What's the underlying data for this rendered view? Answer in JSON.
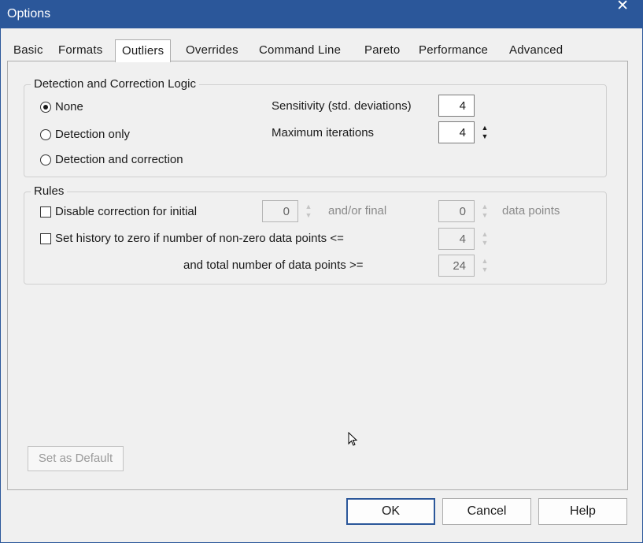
{
  "window": {
    "title": "Options",
    "close_glyph": "✕"
  },
  "tabs": [
    {
      "label": "Basic"
    },
    {
      "label": "Formats"
    },
    {
      "label": "Outliers",
      "active": true
    },
    {
      "label": "Overrides"
    },
    {
      "label": "Command Line"
    },
    {
      "label": "Pareto"
    },
    {
      "label": "Performance"
    },
    {
      "label": "Advanced"
    }
  ],
  "detection": {
    "title": "Detection and Correction Logic",
    "options": [
      {
        "label": "None",
        "selected": true
      },
      {
        "label": "Detection only",
        "selected": false
      },
      {
        "label": "Detection and correction",
        "selected": false
      }
    ],
    "sensitivity": {
      "label": "Sensitivity (std. deviations)",
      "value": "4"
    },
    "max_iterations": {
      "label": "Maximum iterations",
      "value": "4"
    }
  },
  "rules": {
    "title": "Rules",
    "disable_correction": {
      "label": "Disable correction for initial",
      "initial_value": "0",
      "andor_label": "and/or final",
      "final_value": "0",
      "data_points_label": "data points"
    },
    "set_history": {
      "label": "Set history to zero if number of non-zero data points <=",
      "value": "4"
    },
    "total_points": {
      "label": "and total number of data points >=",
      "value": "24"
    }
  },
  "buttons": {
    "set_default": "Set as Default",
    "ok": "OK",
    "cancel": "Cancel",
    "help": "Help"
  },
  "icons": {
    "arrow_up": "▲",
    "arrow_down": "▼"
  }
}
